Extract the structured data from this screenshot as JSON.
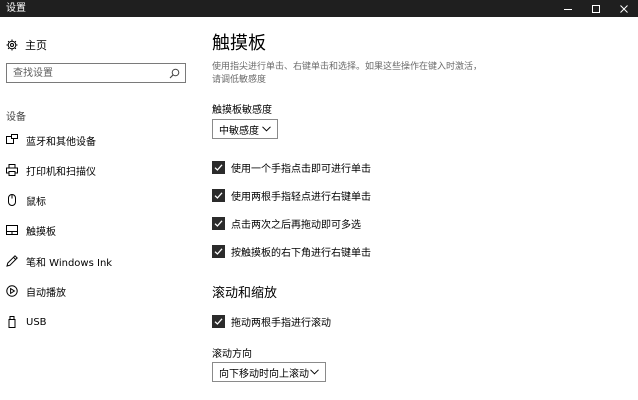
{
  "window": {
    "title": "设置"
  },
  "nav": {
    "home_label": "主页",
    "search_placeholder": "查找设置",
    "group_label": "设备",
    "items": [
      {
        "label": "蓝牙和其他设备",
        "icon": "bluetooth-icon"
      },
      {
        "label": "打印机和扫描仪",
        "icon": "printer-icon"
      },
      {
        "label": "鼠标",
        "icon": "mouse-icon"
      },
      {
        "label": "触摸板",
        "icon": "touchpad-icon"
      },
      {
        "label": "笔和 Windows Ink",
        "icon": "pen-icon"
      },
      {
        "label": "自动播放",
        "icon": "autoplay-icon"
      },
      {
        "label": "USB",
        "icon": "usb-icon"
      }
    ]
  },
  "main": {
    "title": "触摸板",
    "description": "使用指尖进行单击、右键单击和选择。如果这些操作在键入时激活，请调低敏感度",
    "sensitivity_label": "触摸板敏感度",
    "sensitivity_value": "中敏感度",
    "checkboxes": [
      {
        "label": "使用一个手指点击即可进行单击",
        "checked": true
      },
      {
        "label": "使用两根手指轻点进行右键单击",
        "checked": true
      },
      {
        "label": "点击两次之后再拖动即可多选",
        "checked": true
      },
      {
        "label": "按触摸板的右下角进行右键单击",
        "checked": true
      }
    ],
    "scroll_section_title": "滚动和缩放",
    "scroll_checkbox": {
      "label": "拖动两根手指进行滚动",
      "checked": true
    },
    "scroll_direction_label": "滚动方向",
    "scroll_direction_value": "向下移动时向上滚动"
  }
}
